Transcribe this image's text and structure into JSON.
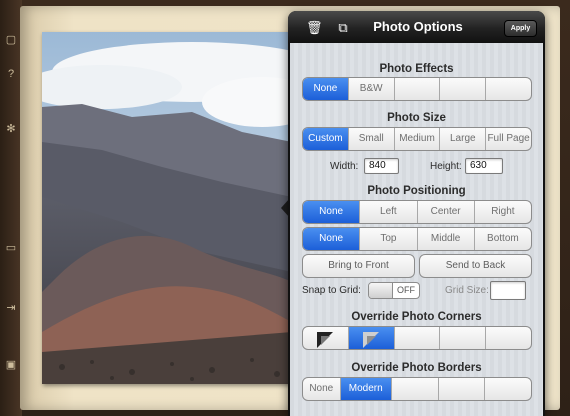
{
  "popover": {
    "title": "Photo Options",
    "apply_label": "Apply",
    "header_icons": [
      "trash-icon",
      "layers-icon"
    ]
  },
  "rail_icons": [
    "help-icon",
    "settings-icon",
    "pages-icon",
    "export-icon",
    "delete-icon"
  ],
  "photo": {
    "subject": "volcanic crater landscape"
  },
  "photo_effects": {
    "title": "Photo Effects",
    "options": [
      "None",
      "B&W",
      "",
      "",
      ""
    ],
    "selected": 0
  },
  "photo_size": {
    "title": "Photo Size",
    "options": [
      "Custom",
      "Small",
      "Medium",
      "Large",
      "Full Page"
    ],
    "selected": 0,
    "width_label": "Width:",
    "width_value": "840",
    "height_label": "Height:",
    "height_value": "630"
  },
  "photo_positioning": {
    "title": "Photo Positioning",
    "horizontal": [
      "None",
      "Left",
      "Center",
      "Right"
    ],
    "horizontal_selected": 0,
    "vertical": [
      "None",
      "Top",
      "Middle",
      "Bottom"
    ],
    "vertical_selected": 0,
    "bring_to_front": "Bring to Front",
    "send_to_back": "Send to Back"
  },
  "snap": {
    "label": "Snap to Grid:",
    "toggle_text": "OFF",
    "grid_size_label": "Grid Size:",
    "grid_size_value": ""
  },
  "override_corners": {
    "title": "Override Photo Corners",
    "options": [
      "",
      "",
      "",
      "",
      ""
    ],
    "selected": 1
  },
  "override_borders": {
    "title": "Override Photo Borders",
    "options": [
      "None",
      "Modern",
      "",
      "",
      ""
    ],
    "selected": 1
  },
  "colors": {
    "selected_segment": "#1c5fd8",
    "header": "#111111"
  }
}
